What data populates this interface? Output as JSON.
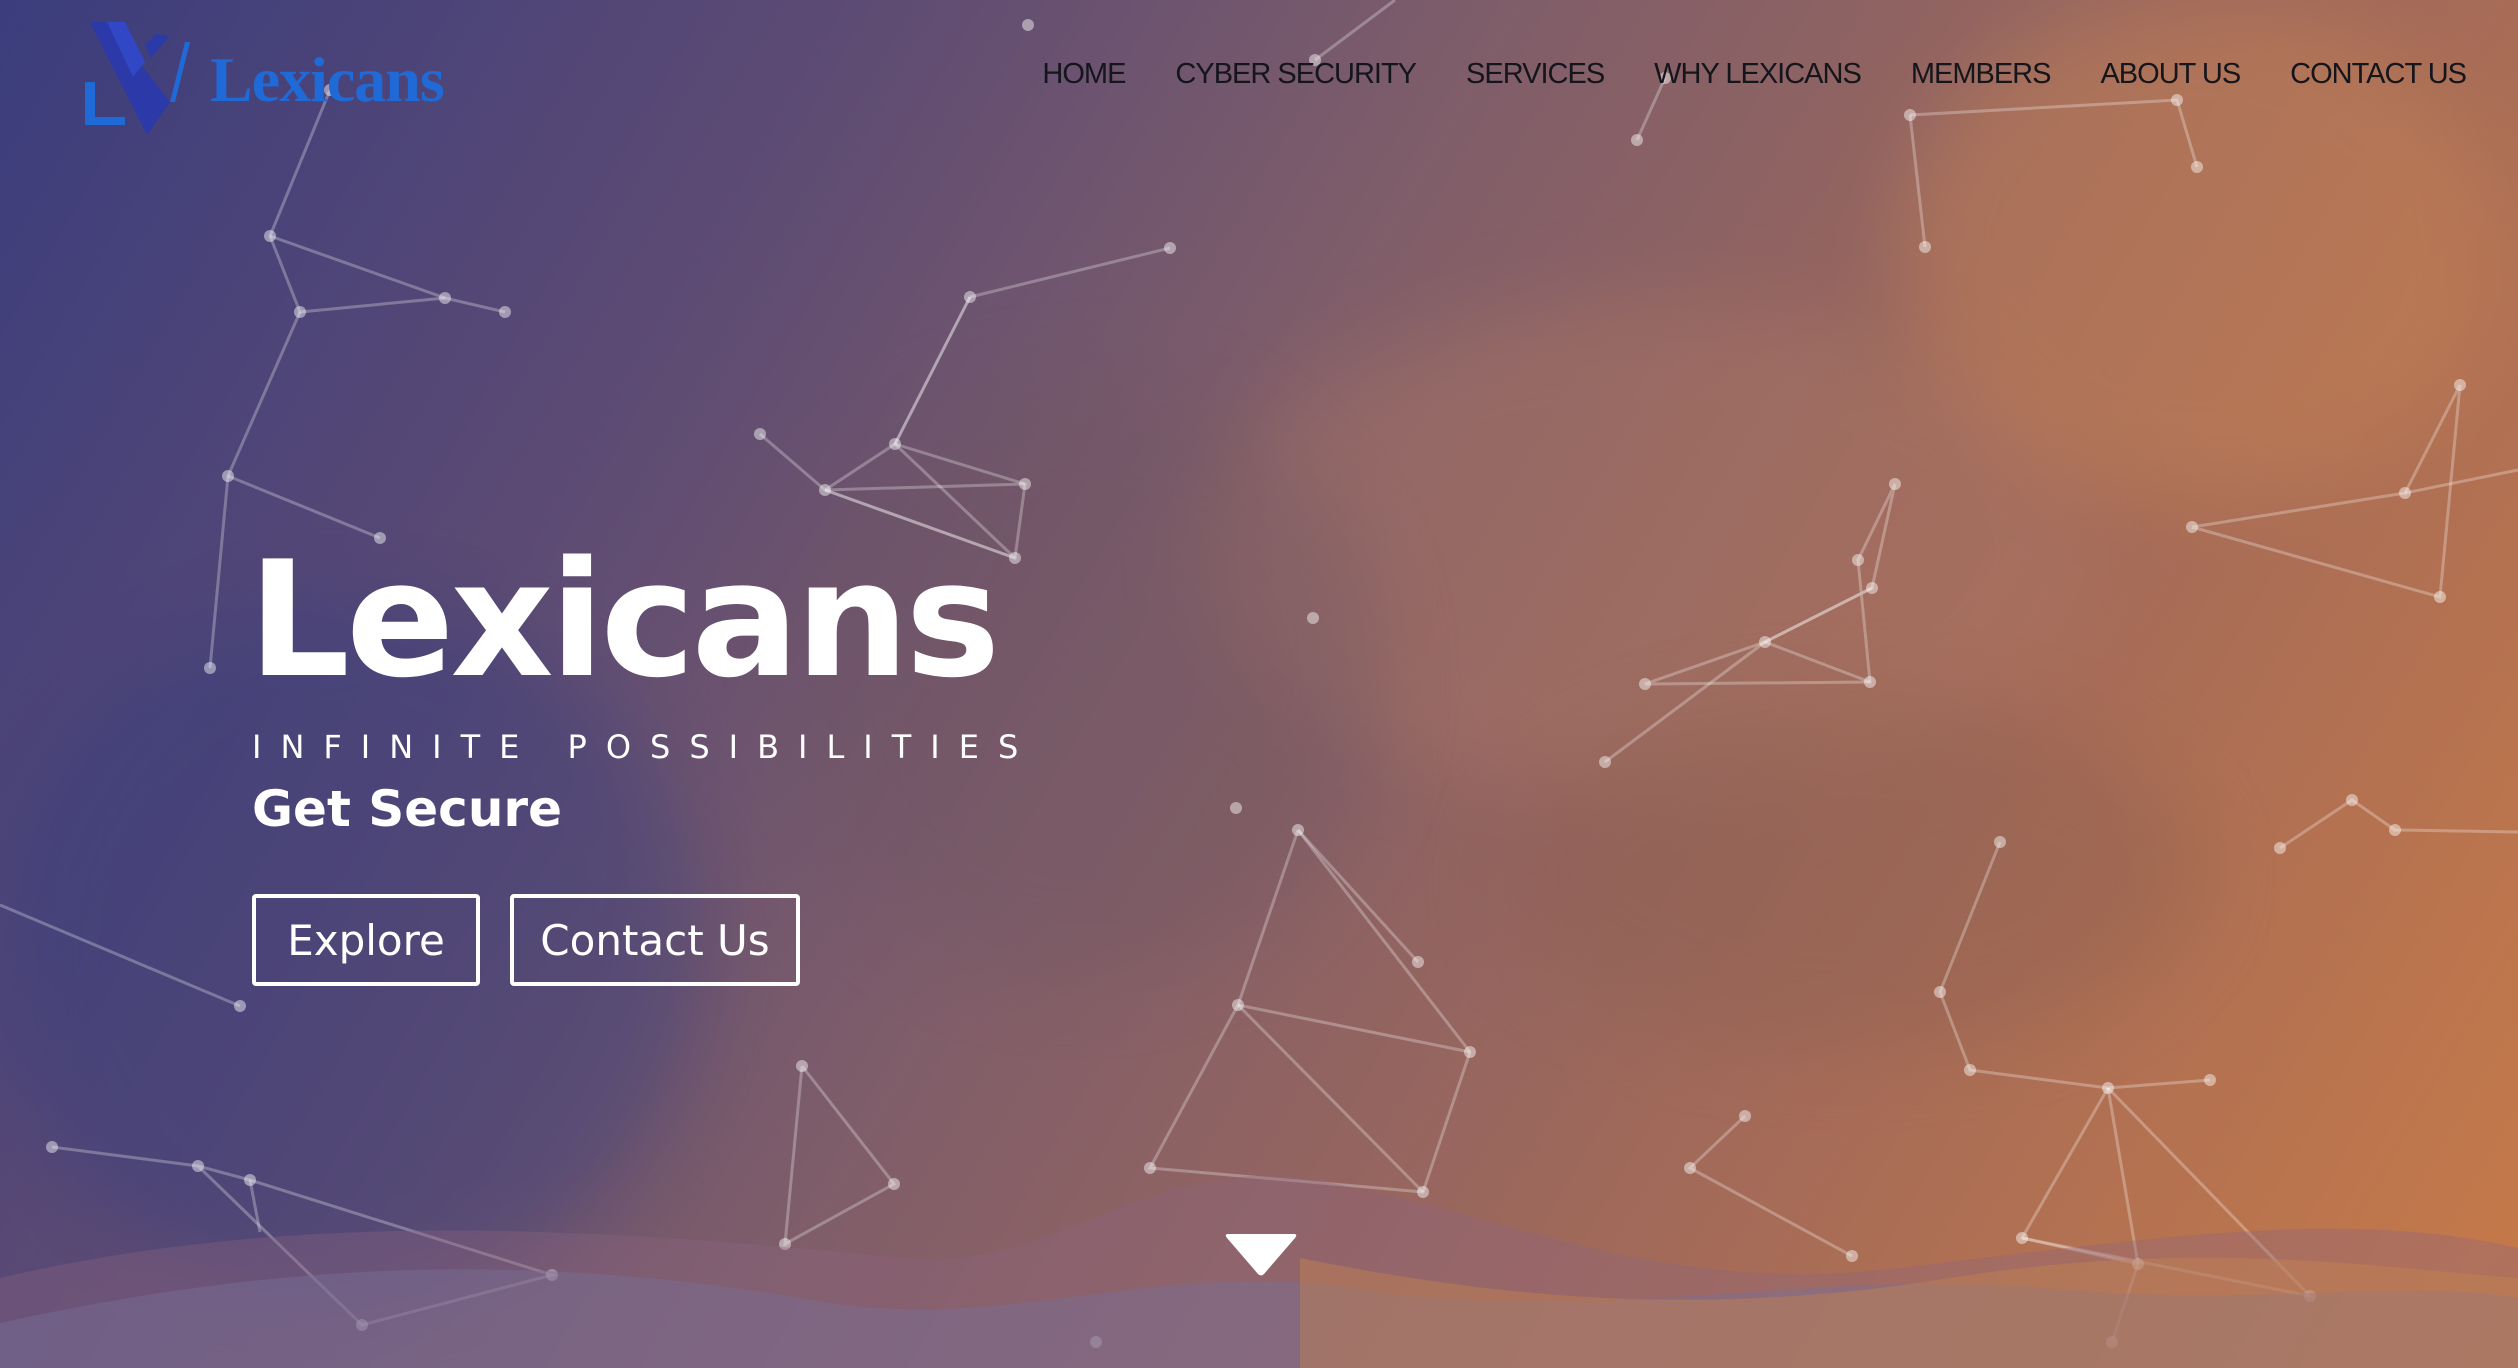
{
  "brand": {
    "name": "Lexicans",
    "logo_color": "#1f6ad6",
    "logo_mark_color": "#2b3aa8"
  },
  "nav": {
    "items": [
      {
        "label": "HOME"
      },
      {
        "label": "CYBER SECURITY"
      },
      {
        "label": "SERVICES"
      },
      {
        "label": "WHY LEXICANS"
      },
      {
        "label": "MEMBERS"
      },
      {
        "label": "ABOUT US"
      },
      {
        "label": "CONTACT US"
      }
    ]
  },
  "hero": {
    "title": "Lexicans",
    "tagline": "INFINITE POSSIBILITIES",
    "subtitle": "Get Secure",
    "buttons": {
      "explore": "Explore",
      "contact": "Contact Us"
    },
    "scroll_icon": "triangle-down-icon"
  },
  "colors": {
    "gradient_start": "#3b3d7d",
    "gradient_end": "#c77a48",
    "text": "#ffffff",
    "nav_text": "#15151c"
  }
}
